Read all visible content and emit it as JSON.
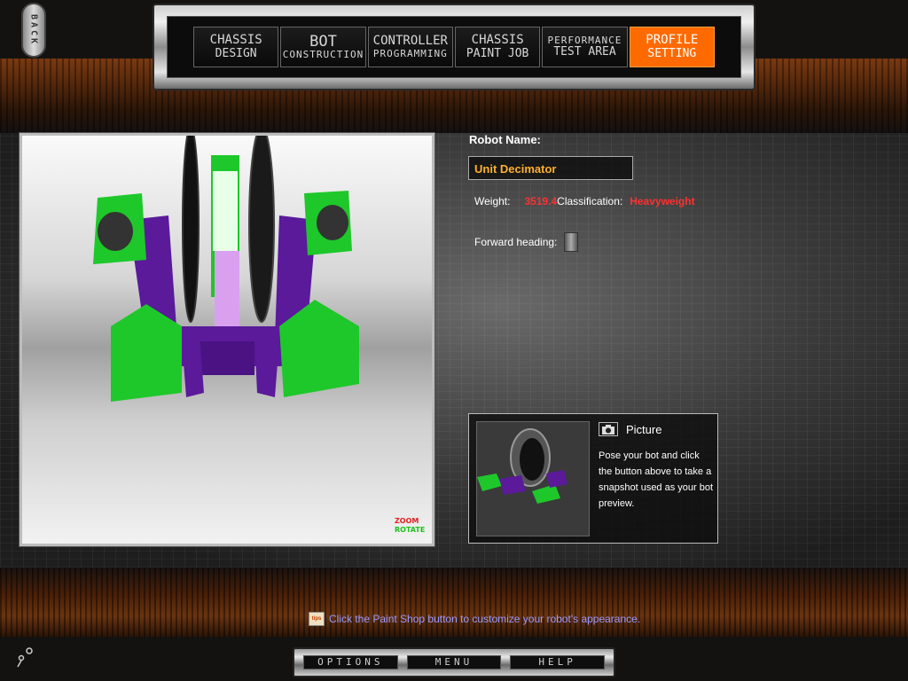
{
  "nav": {
    "back_label": "BACK",
    "tabs": [
      {
        "line1": "CHASSIS",
        "line2": "DESIGN"
      },
      {
        "line1": "BOT",
        "line2": "CONSTRUCTION"
      },
      {
        "line1": "CONTROLLER",
        "line2": "PROGRAMMING"
      },
      {
        "line1": "CHASSIS",
        "line2": "PAINT JOB"
      },
      {
        "line1": "PERFORMANCE",
        "line2": "TEST AREA"
      },
      {
        "line1": "PROFILE",
        "line2": "SETTING"
      }
    ],
    "active_tab": "PROFILE SETTING"
  },
  "viewport": {
    "zoom_label": "ZOOM",
    "rotate_label": "ROTATE"
  },
  "profile": {
    "robot_name_label": "Robot Name:",
    "robot_name_value": "Unit Decimator",
    "weight_label": "Weight:",
    "weight_value": "3519.4",
    "classification_label": "Classification:",
    "classification_value": "Heavyweight",
    "forward_heading_label": "Forward heading:"
  },
  "picture": {
    "title": "Picture",
    "description": "Pose your bot and click the button above to take a snapshot used as your bot preview."
  },
  "tip": {
    "icon_label": "tips",
    "text": "Click the Paint Shop button to customize your robot's appearance."
  },
  "bottom_menu": {
    "options_label": "OPTIONS",
    "menu_label": "MENU",
    "help_label": "HELP"
  },
  "colors": {
    "active_tab": "#ff6a00",
    "robot_name": "#ffb030",
    "stat_values": "#ff3030",
    "tip_text": "#9a9aff",
    "robot_green": "#1ec82a",
    "robot_purple": "#5a1a9a"
  },
  "icons": [
    "camera-icon",
    "tips-icon",
    "settings-knob-icon"
  ]
}
